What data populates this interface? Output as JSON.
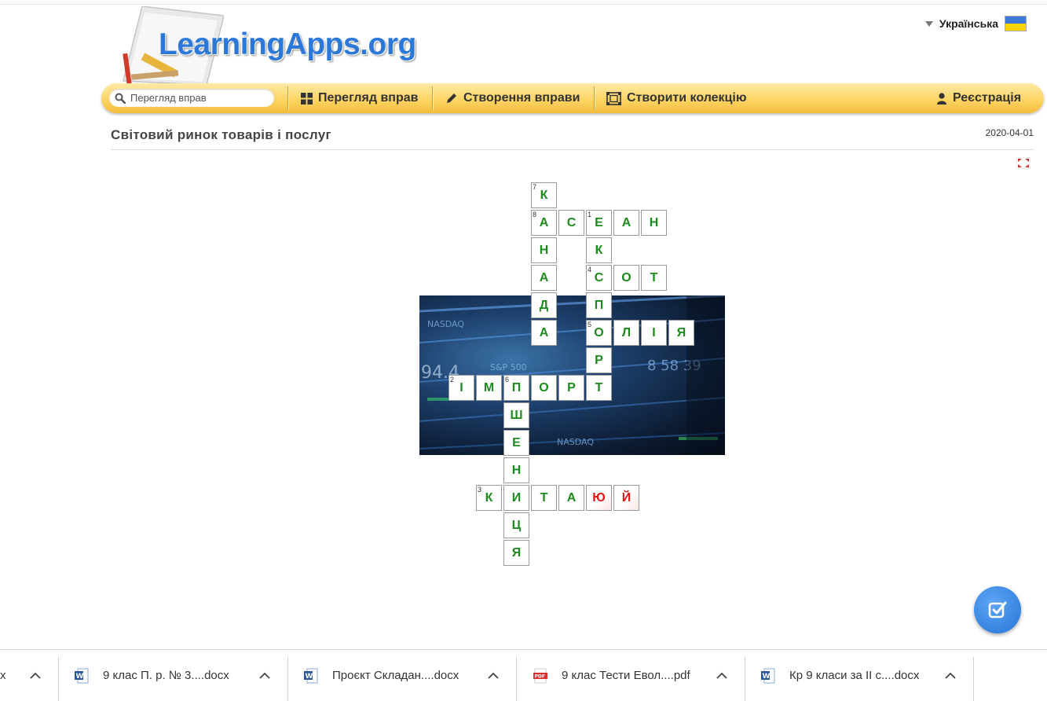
{
  "header": {
    "logo_text": "LearningApps.org",
    "language": "Українська"
  },
  "nav": {
    "search_placeholder": "Перегляд вправ",
    "browse_label": "Перегляд вправ",
    "create_label": "Створення вправи",
    "collection_label": "Створити колекцію",
    "register_label": "Реєстрація"
  },
  "exercise": {
    "title": "Світовий ринок товарів і послуг",
    "date": "2020-04-01"
  },
  "crossword": {
    "cells": [
      {
        "col": 4,
        "row": 0,
        "letter": "К",
        "num": "7"
      },
      {
        "col": 4,
        "row": 1,
        "letter": "А",
        "num": "8"
      },
      {
        "col": 5,
        "row": 1,
        "letter": "С"
      },
      {
        "col": 6,
        "row": 1,
        "letter": "Е",
        "num": "1"
      },
      {
        "col": 7,
        "row": 1,
        "letter": "А"
      },
      {
        "col": 8,
        "row": 1,
        "letter": "Н"
      },
      {
        "col": 4,
        "row": 2,
        "letter": "Н"
      },
      {
        "col": 6,
        "row": 2,
        "letter": "К"
      },
      {
        "col": 4,
        "row": 3,
        "letter": "А"
      },
      {
        "col": 6,
        "row": 3,
        "letter": "С",
        "num": "4"
      },
      {
        "col": 7,
        "row": 3,
        "letter": "О"
      },
      {
        "col": 8,
        "row": 3,
        "letter": "Т"
      },
      {
        "col": 4,
        "row": 4,
        "letter": "Д"
      },
      {
        "col": 6,
        "row": 4,
        "letter": "П"
      },
      {
        "col": 4,
        "row": 5,
        "letter": "А"
      },
      {
        "col": 6,
        "row": 5,
        "letter": "О",
        "num": "5"
      },
      {
        "col": 7,
        "row": 5,
        "letter": "Л"
      },
      {
        "col": 8,
        "row": 5,
        "letter": "І"
      },
      {
        "col": 9,
        "row": 5,
        "letter": "Я"
      },
      {
        "col": 6,
        "row": 6,
        "letter": "Р"
      },
      {
        "col": 1,
        "row": 7,
        "letter": "І",
        "num": "2"
      },
      {
        "col": 2,
        "row": 7,
        "letter": "М"
      },
      {
        "col": 3,
        "row": 7,
        "letter": "П",
        "num": "6"
      },
      {
        "col": 4,
        "row": 7,
        "letter": "О"
      },
      {
        "col": 5,
        "row": 7,
        "letter": "Р"
      },
      {
        "col": 6,
        "row": 7,
        "letter": "Т"
      },
      {
        "col": 3,
        "row": 8,
        "letter": "Ш"
      },
      {
        "col": 3,
        "row": 9,
        "letter": "Е"
      },
      {
        "col": 3,
        "row": 10,
        "letter": "Н"
      },
      {
        "col": 2,
        "row": 11,
        "letter": "К",
        "num": "3"
      },
      {
        "col": 3,
        "row": 11,
        "letter": "И"
      },
      {
        "col": 4,
        "row": 11,
        "letter": "Т"
      },
      {
        "col": 5,
        "row": 11,
        "letter": "А"
      },
      {
        "col": 6,
        "row": 11,
        "letter": "Ю",
        "status": "wrong"
      },
      {
        "col": 7,
        "row": 11,
        "letter": "Й",
        "status": "wrong"
      },
      {
        "col": 3,
        "row": 12,
        "letter": "Ц"
      },
      {
        "col": 3,
        "row": 13,
        "letter": "Я"
      }
    ],
    "correct_color": "#1c8a1c",
    "wrong_color": "#e01212"
  },
  "downloads": [
    {
      "name": "x",
      "icon": "none"
    },
    {
      "name": "9 клас П. р. № 3....docx",
      "icon": "word-icon"
    },
    {
      "name": "Проєкт Складан....docx",
      "icon": "word-icon"
    },
    {
      "name": "9 клас Тести Евол....pdf",
      "icon": "pdf-icon"
    },
    {
      "name": "Кр 9 класи за ІІ с....docx",
      "icon": "word-icon"
    }
  ],
  "colors": {
    "nav_gold": "#fdd565",
    "brand_blue": "#2b78d8",
    "check_button": "#2574d6"
  }
}
